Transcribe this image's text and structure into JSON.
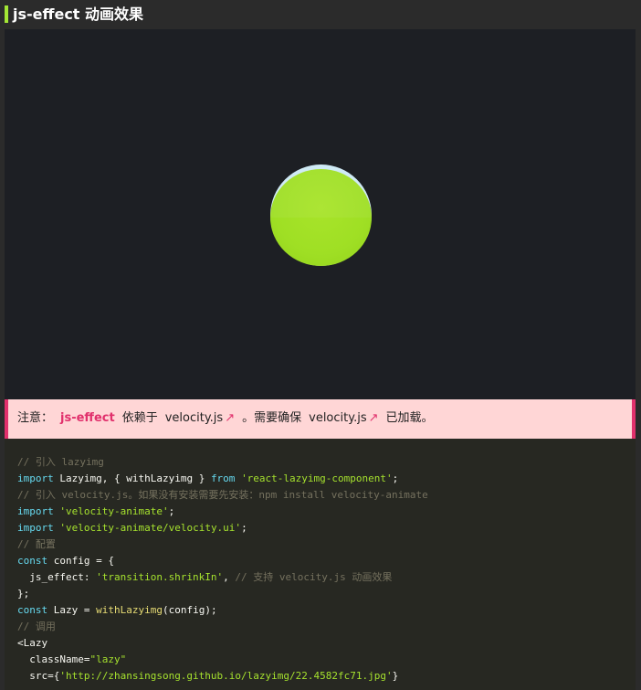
{
  "header": {
    "title": "js-effect 动画效果"
  },
  "note": {
    "label": "注意：",
    "highlight": "js-effect",
    "text1": "依赖于",
    "link1": "velocity.js",
    "text2": "。需要确保",
    "link2": "velocity.js",
    "text3": "已加载。",
    "link_icon": "↗"
  },
  "colors": {
    "accent": "#a3e635",
    "ball": "#9fdf24",
    "note_bg": "#ffd6d6",
    "note_accent": "#e1306c",
    "code_bg": "#272822"
  },
  "code": {
    "lines": [
      [
        {
          "cls": "c",
          "text": "// 引入 lazyimg"
        }
      ],
      [
        {
          "cls": "k",
          "text": "import"
        },
        {
          "cls": "t",
          "text": " Lazyimg, { withLazyimg } "
        },
        {
          "cls": "k",
          "text": "from"
        },
        {
          "cls": "t",
          "text": " "
        },
        {
          "cls": "s",
          "text": "'react-lazyimg-component'"
        },
        {
          "cls": "t",
          "text": ";"
        }
      ],
      [
        {
          "cls": "c",
          "text": "// 引入 velocity.js。如果没有安装需要先安装：npm install velocity-animate"
        }
      ],
      [
        {
          "cls": "k",
          "text": "import"
        },
        {
          "cls": "t",
          "text": " "
        },
        {
          "cls": "s",
          "text": "'velocity-animate'"
        },
        {
          "cls": "t",
          "text": ";"
        }
      ],
      [
        {
          "cls": "k",
          "text": "import"
        },
        {
          "cls": "t",
          "text": " "
        },
        {
          "cls": "s",
          "text": "'velocity-animate/velocity.ui'"
        },
        {
          "cls": "t",
          "text": ";"
        }
      ],
      [
        {
          "cls": "c",
          "text": "// 配置"
        }
      ],
      [
        {
          "cls": "k",
          "text": "const"
        },
        {
          "cls": "t",
          "text": " config = {"
        }
      ],
      [
        {
          "cls": "t",
          "text": "  js_effect: "
        },
        {
          "cls": "s",
          "text": "'transition.shrinkIn'"
        },
        {
          "cls": "t",
          "text": ", "
        },
        {
          "cls": "c",
          "text": "// 支持 velocity.js 动画效果"
        }
      ],
      [
        {
          "cls": "t",
          "text": "};"
        }
      ],
      [
        {
          "cls": "k",
          "text": "const"
        },
        {
          "cls": "t",
          "text": " Lazy = "
        },
        {
          "cls": "f",
          "text": "withLazyimg"
        },
        {
          "cls": "t",
          "text": "(config);"
        }
      ],
      [
        {
          "cls": "c",
          "text": "// 调用"
        }
      ],
      [
        {
          "cls": "t",
          "text": "<Lazy"
        }
      ],
      [
        {
          "cls": "t",
          "text": "  className="
        },
        {
          "cls": "s",
          "text": "\"lazy\""
        }
      ],
      [
        {
          "cls": "t",
          "text": "  src={"
        },
        {
          "cls": "s",
          "text": "'http://zhansingsong.github.io/lazyimg/22.4582fc71.jpg'"
        },
        {
          "cls": "t",
          "text": "}"
        }
      ]
    ]
  }
}
